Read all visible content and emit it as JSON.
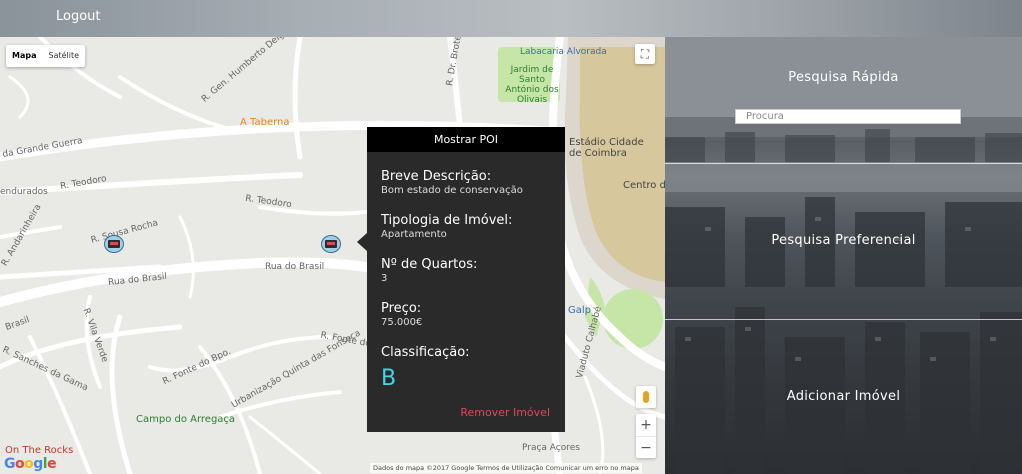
{
  "header": {
    "logout_label": "Logout"
  },
  "map": {
    "type_buttons": [
      "Mapa",
      "Satélite"
    ],
    "fullscreen_icon": "fullscreen-icon",
    "zoom_in": "+",
    "zoom_out": "−",
    "google_logo": "Google",
    "attribution": "Dados do mapa ©2017 Google    Termos de Utilização    Comunicar um erro no mapa",
    "streets": {
      "humberto": "R. Gen. Humberto Delgado",
      "brotero": "R. Dr. Brotero",
      "grande_guerra": "da Grande Guerra",
      "teodoro1": "R. Teodoro",
      "teodoro2": "R. Teodoro",
      "enduradas": "endurados",
      "sousa_rocha": "R. Sousa Rocha",
      "andarinheira": "R. Andarinheira",
      "brasil1": "Rua do Brasil",
      "brasil2": "Rua do Brasil",
      "brasil3": "Brasil",
      "vila_verde": "R. Vila Verde",
      "sanches": "R. Sanches da Gama",
      "fonte_bpo": "R. Fonte do Bpo.",
      "fonte_bpo2": "R. Fonte do Bpo.",
      "quinta": "Urbanização Quinta das Fonseca",
      "centro": "Centro de",
      "vasco": "Viaduto Calhabé",
      "praca": "Praça Açores"
    },
    "pois": {
      "taberna": "A Taberna",
      "jardim": "Jardim de Santo António dos Olivais",
      "alvorada": "Labacaria Alvorada",
      "estadio": "Estádio Cidade de Coimbra",
      "campo": "Campo do Arregaça",
      "rocks": "On The Rocks",
      "galp": "Galp"
    },
    "colors": {
      "road": "#ffffff",
      "park": "#c5e6a6",
      "water": "#aadaff",
      "marker": "#9fd0e8"
    }
  },
  "poi_panel": {
    "title": "Mostrar POI",
    "fields": [
      {
        "label": "Breve Descrição:",
        "value": "Bom estado de conservação"
      },
      {
        "label": "Tipologia de Imóvel:",
        "value": "Apartamento"
      },
      {
        "label": "Nº de Quartos:",
        "value": "3"
      },
      {
        "label": "Preço:",
        "value": "75.000€"
      }
    ],
    "rating_label": "Classificação:",
    "rating_value": "B",
    "remove_label": "Remover Imóvel",
    "accent": "#3fd6e8",
    "remove_color": "#e0475a"
  },
  "side": {
    "quick_search_title": "Pesquisa Rápida",
    "search_placeholder": "Procura",
    "preferential_title": "Pesquisa Preferencial",
    "add_property_title": "Adicionar Imóvel"
  }
}
